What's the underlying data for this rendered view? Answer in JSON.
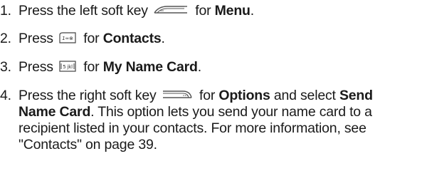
{
  "steps": [
    {
      "number": "1.",
      "lines": [
        {
          "pre": "Press the left soft key",
          "key": "left-soft-key-icon",
          "mid": "for",
          "bold": "Menu",
          "post": "."
        }
      ]
    },
    {
      "number": "2.",
      "lines": [
        {
          "pre": "Press",
          "key": "1-key-icon",
          "key_text": "1∞⊗",
          "mid": "for",
          "bold": "Contacts",
          "post": "."
        }
      ]
    },
    {
      "number": "3.",
      "lines": [
        {
          "pre": "Press",
          "key": "5-key-icon",
          "key_text": "5 jkl",
          "mid": "for",
          "bold": "My Name Card",
          "post": "."
        }
      ]
    },
    {
      "number": "4.",
      "line1": {
        "pre": "Press the right soft key",
        "key": "right-soft-key-icon",
        "mid": "for",
        "bold1": "Options",
        "mid2": "and select",
        "bold2": "Send"
      },
      "line2": {
        "bold": "Name Card",
        "post": ". This option lets you send your name card to a"
      },
      "line3": "recipient listed in your contacts. For more information, see",
      "line4": "\"Contacts\" on page 39."
    }
  ]
}
